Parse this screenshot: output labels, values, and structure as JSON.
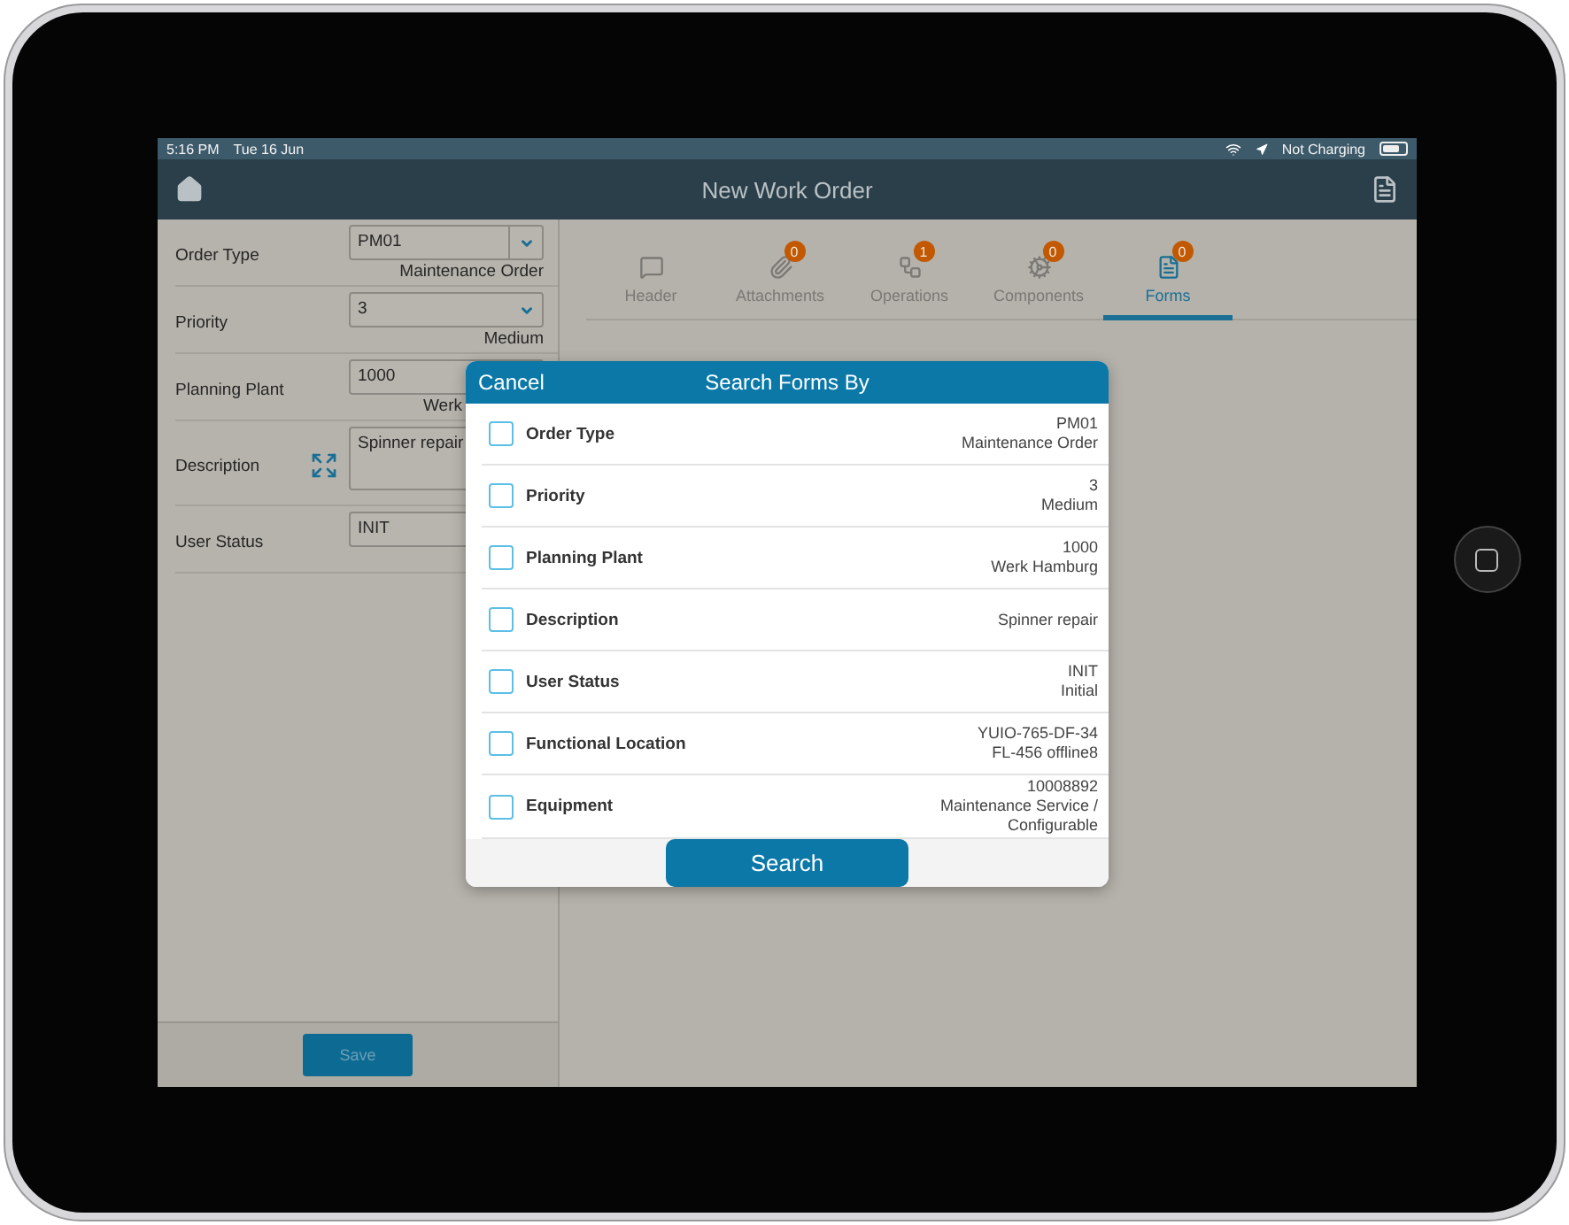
{
  "status_bar": {
    "time": "5:16 PM",
    "date": "Tue 16 Jun",
    "charging": "Not Charging"
  },
  "nav": {
    "title": "New Work Order"
  },
  "form": {
    "fields": [
      {
        "label": "Order Type",
        "kind": "select-boxed",
        "value": "PM01",
        "sublabel": "Maintenance Order"
      },
      {
        "label": "Priority",
        "kind": "select",
        "value": "3",
        "sublabel": "Medium"
      },
      {
        "label": "Planning Plant",
        "kind": "text",
        "value": "1000",
        "sublabel": "Werk"
      },
      {
        "label": "Description",
        "kind": "textarea",
        "value": "Spinner repair"
      },
      {
        "label": "User Status",
        "kind": "text",
        "value": "INIT"
      }
    ],
    "save": "Save"
  },
  "tabs": [
    {
      "label": "Header",
      "selected": false
    },
    {
      "label": "Attachments",
      "badge": "0",
      "selected": false
    },
    {
      "label": "Operations",
      "badge": "1",
      "selected": false
    },
    {
      "label": "Components",
      "badge": "0",
      "selected": false
    },
    {
      "label": "Forms",
      "badge": "0",
      "selected": true
    }
  ],
  "dialog": {
    "cancel": "Cancel",
    "title": "Search Forms By",
    "options": [
      {
        "label": "Order Type",
        "checked": false,
        "values": [
          "PM01",
          "Maintenance Order"
        ]
      },
      {
        "label": "Priority",
        "checked": false,
        "values": [
          "3",
          "Medium"
        ]
      },
      {
        "label": "Planning Plant",
        "checked": false,
        "values": [
          "1000",
          "Werk Hamburg"
        ]
      },
      {
        "label": "Description",
        "checked": false,
        "values": [
          "Spinner repair"
        ]
      },
      {
        "label": "User Status",
        "checked": false,
        "values": [
          "INIT",
          "Initial"
        ]
      },
      {
        "label": "Functional Location",
        "checked": false,
        "values": [
          "YUIO-765-DF-34",
          "FL-456 offline8"
        ]
      },
      {
        "label": "Equipment",
        "checked": false,
        "values": [
          "10008892",
          "Maintenance Service /",
          "Configurable"
        ]
      }
    ],
    "search": "Search"
  }
}
